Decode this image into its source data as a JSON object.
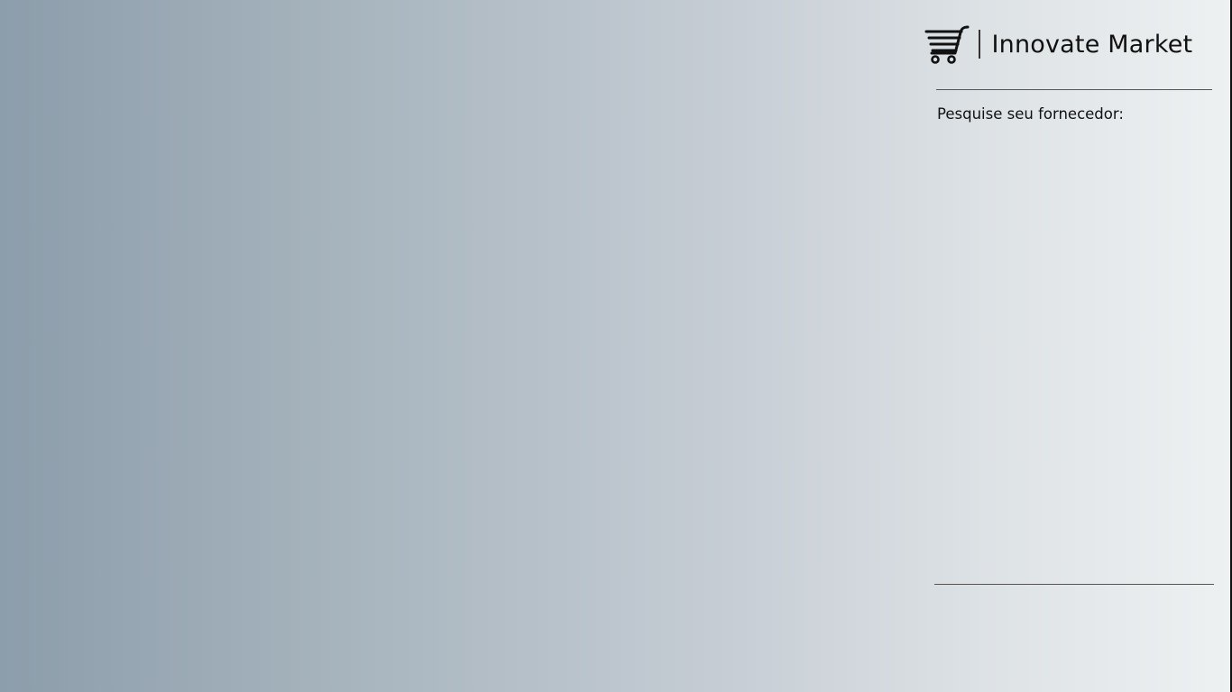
{
  "brand": {
    "name": "Innovate Market",
    "icon": "shopping-cart-icon"
  },
  "search": {
    "label": "Pesquise seu fornecedor:"
  }
}
